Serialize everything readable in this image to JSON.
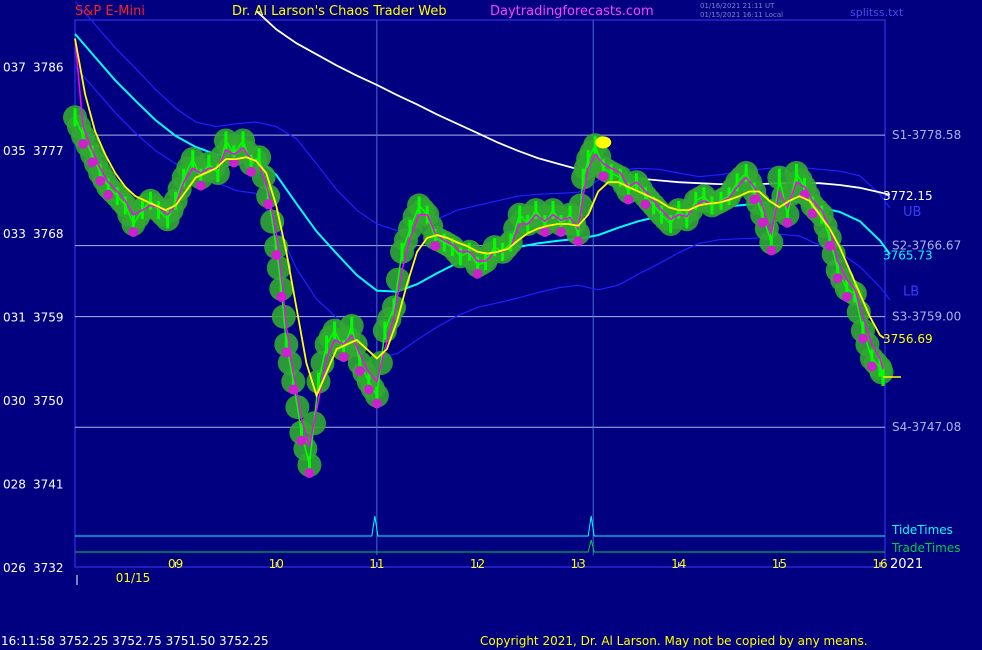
{
  "header": {
    "instrument": "S&P E-Mini",
    "author": "Dr. Al Larson's Chaos Trader Web",
    "site": "Daytradingforecasts.com",
    "stamp_ut": "01/16/2021 21:11 UT",
    "stamp_local": "01/15/2021 16:11 Local",
    "file": "splitss.txt"
  },
  "footer": {
    "quote": "16:11:58  3752.25 3752.75 3751.50 3752.25",
    "copyright": "Copyright 2021, Dr. Al Larson. May not be copied by any means."
  },
  "colors": {
    "background": "#000080",
    "price": "#00ff00",
    "glow": "#32a832",
    "ema_fast": "#ff00ff",
    "ema_slow": "#ffff00",
    "long_ma": "#ffffff",
    "band_mid": "#00ffff",
    "band_edge": "#2020ff",
    "grid": "#aab4ee"
  },
  "chart_data": {
    "type": "line",
    "title": "S&P E-Mini",
    "x_unit": "hour of 01/15",
    "xlim": [
      8.0,
      16.05
    ],
    "ylim": [
      3732,
      3791
    ],
    "x_date_label": "01/15",
    "x_year_label": "2021",
    "x_ticks": [
      {
        "x": 9,
        "label": "09"
      },
      {
        "x": 10,
        "label": "10"
      },
      {
        "x": 11,
        "label": "11"
      },
      {
        "x": 12,
        "label": "12"
      },
      {
        "x": 13,
        "label": "13"
      },
      {
        "x": 14,
        "label": "14"
      },
      {
        "x": 15,
        "label": "15"
      },
      {
        "x": 16,
        "label": "16"
      }
    ],
    "y_ticks": [
      {
        "y": 3786,
        "left": "037",
        "label": "3786"
      },
      {
        "y": 3777,
        "left": "035",
        "label": "3777"
      },
      {
        "y": 3768,
        "left": "033",
        "label": "3768"
      },
      {
        "y": 3759,
        "left": "031",
        "label": "3759"
      },
      {
        "y": 3750,
        "left": "030",
        "label": "3750"
      },
      {
        "y": 3741,
        "left": "028",
        "label": "3741"
      },
      {
        "y": 3732,
        "left": "026",
        "label": "3732"
      }
    ],
    "levels": [
      {
        "name": "S1",
        "value": 3778.58,
        "label": "S1-3778.58"
      },
      {
        "name": "S2",
        "value": 3766.67,
        "label": "S2-3766.67"
      },
      {
        "name": "S3",
        "value": 3759.0,
        "label": "S3-3759.00"
      },
      {
        "name": "S4",
        "value": 3747.08,
        "label": "S4-3747.08"
      }
    ],
    "right_values": [
      {
        "value": 3772.15,
        "label": "3772.15",
        "color": "#ffffff"
      },
      {
        "value": 3765.73,
        "label": "3765.73",
        "color": "#00ffff"
      },
      {
        "value": 3756.69,
        "label": "3756.69",
        "color": "#ffff00"
      }
    ],
    "band_labels": [
      {
        "text": "UB",
        "value": 3770.3
      },
      {
        "text": "LB",
        "value": 3761.7
      }
    ],
    "vertical_markers": [
      11.0,
      13.15
    ],
    "timing_rows": [
      {
        "name": "TideTimes",
        "color": "#00ffff",
        "spikes": [
          10.98,
          13.13
        ]
      },
      {
        "name": "TradeTimes",
        "color": "#00cc44",
        "spikes": [
          13.13
        ]
      }
    ],
    "series": [
      {
        "name": "price",
        "x": [
          8.0,
          8.08,
          8.17,
          8.25,
          8.33,
          8.42,
          8.5,
          8.58,
          8.67,
          8.75,
          8.83,
          8.92,
          9.0,
          9.08,
          9.17,
          9.25,
          9.33,
          9.42,
          9.5,
          9.58,
          9.67,
          9.75,
          9.83,
          9.92,
          10.0,
          10.05,
          10.1,
          10.17,
          10.25,
          10.33,
          10.42,
          10.5,
          10.58,
          10.67,
          10.75,
          10.83,
          10.92,
          11.0,
          11.08,
          11.17,
          11.25,
          11.33,
          11.42,
          11.5,
          11.58,
          11.67,
          11.75,
          11.83,
          11.92,
          12.0,
          12.08,
          12.17,
          12.25,
          12.33,
          12.42,
          12.5,
          12.58,
          12.67,
          12.75,
          12.83,
          12.92,
          13.0,
          13.05,
          13.1,
          13.17,
          13.25,
          13.33,
          13.42,
          13.5,
          13.58,
          13.67,
          13.75,
          13.83,
          13.92,
          14.0,
          14.08,
          14.17,
          14.25,
          14.33,
          14.42,
          14.5,
          14.58,
          14.67,
          14.75,
          14.83,
          14.92,
          15.0,
          15.08,
          15.17,
          15.25,
          15.33,
          15.42,
          15.5,
          15.58,
          15.67,
          15.75,
          15.83,
          15.92,
          16.0,
          16.03
        ],
        "y": [
          3780.5,
          3778.5,
          3776.5,
          3774.5,
          3773,
          3772,
          3771,
          3769,
          3770.5,
          3771.5,
          3770.5,
          3769.5,
          3771.5,
          3774,
          3776,
          3774,
          3775.5,
          3774.5,
          3778,
          3776.5,
          3778,
          3775.5,
          3776.2,
          3772,
          3766.5,
          3762,
          3756,
          3752,
          3746.5,
          3743,
          3752,
          3756,
          3757.5,
          3755.5,
          3758,
          3754,
          3752,
          3750.5,
          3757.5,
          3760,
          3766,
          3768.5,
          3771,
          3770,
          3767.5,
          3767,
          3766.5,
          3765.5,
          3766,
          3764.5,
          3765,
          3766.5,
          3766,
          3767,
          3770,
          3769,
          3770.5,
          3769,
          3770.5,
          3769,
          3770,
          3768,
          3774,
          3776,
          3777.5,
          3775,
          3774.5,
          3774,
          3772.5,
          3773.5,
          3772,
          3771,
          3770,
          3769,
          3770.5,
          3769.5,
          3771.5,
          3772,
          3771,
          3771.5,
          3772,
          3773.5,
          3774.5,
          3772.5,
          3770,
          3767,
          3774,
          3770,
          3774.5,
          3773,
          3771,
          3770,
          3767.5,
          3764,
          3762,
          3761.5,
          3757.5,
          3754.5,
          3753.5,
          3752.5
        ]
      },
      {
        "name": "fast_avg",
        "x": [
          8.0,
          8.08,
          8.17,
          8.25,
          8.33,
          8.42,
          8.5,
          8.58,
          8.67,
          8.75,
          8.83,
          8.92,
          9.0,
          9.08,
          9.17,
          9.25,
          9.33,
          9.42,
          9.5,
          9.58,
          9.67,
          9.75,
          9.83,
          9.92,
          10.0,
          10.05,
          10.1,
          10.17,
          10.25,
          10.33,
          10.42,
          10.5,
          10.58,
          10.67,
          10.75,
          10.83,
          10.92,
          11.0,
          11.08,
          11.17,
          11.25,
          11.33,
          11.42,
          11.5,
          11.58,
          11.67,
          11.75,
          11.83,
          11.92,
          12.0,
          12.08,
          12.17,
          12.25,
          12.33,
          12.42,
          12.5,
          12.58,
          12.67,
          12.75,
          12.83,
          12.92,
          13.0,
          13.05,
          13.1,
          13.17,
          13.25,
          13.33,
          13.42,
          13.5,
          13.58,
          13.67,
          13.75,
          13.83,
          13.92,
          14.0,
          14.08,
          14.17,
          14.25,
          14.33,
          14.42,
          14.5,
          14.58,
          14.67,
          14.75,
          14.83,
          14.92,
          15.0,
          15.08,
          15.17,
          15.25,
          15.33,
          15.42,
          15.5,
          15.58,
          15.67,
          15.75,
          15.83,
          15.92,
          16.0,
          16.03
        ],
        "y": [
          3789,
          3779.5,
          3777,
          3775,
          3773.5,
          3772.5,
          3771.5,
          3770,
          3770.5,
          3771,
          3770.8,
          3770,
          3771,
          3773.5,
          3775,
          3774.5,
          3775,
          3775,
          3777,
          3776.5,
          3777.2,
          3776,
          3775.5,
          3772.5,
          3768,
          3763.5,
          3758,
          3753,
          3748,
          3745,
          3750,
          3754.5,
          3756.5,
          3756,
          3757,
          3755,
          3753,
          3752,
          3755.5,
          3759,
          3764,
          3767.5,
          3770,
          3770,
          3768,
          3767.2,
          3766.8,
          3766,
          3766,
          3765,
          3765,
          3766,
          3766,
          3766.5,
          3769,
          3769,
          3770,
          3769.3,
          3770,
          3769.4,
          3769.7,
          3768.5,
          3772,
          3775,
          3776.5,
          3775.5,
          3775,
          3774.5,
          3773,
          3773.5,
          3772.5,
          3771.5,
          3770.5,
          3769.5,
          3770,
          3769.8,
          3771,
          3771.5,
          3771.2,
          3771.4,
          3771.8,
          3773,
          3774,
          3773,
          3771,
          3768,
          3772.5,
          3770.8,
          3773.5,
          3773,
          3771.5,
          3770.5,
          3768.5,
          3765,
          3763,
          3762,
          3759,
          3756,
          3754.5,
          3753.3
        ]
      },
      {
        "name": "slow_avg",
        "x": [
          8.0,
          8.1,
          8.2,
          8.3,
          8.4,
          8.5,
          8.6,
          8.7,
          8.8,
          8.9,
          9.0,
          9.1,
          9.2,
          9.3,
          9.4,
          9.5,
          9.6,
          9.7,
          9.8,
          9.9,
          10.0,
          10.1,
          10.2,
          10.3,
          10.4,
          10.5,
          10.6,
          10.7,
          10.8,
          10.9,
          11.0,
          11.1,
          11.2,
          11.3,
          11.4,
          11.5,
          11.6,
          11.7,
          11.8,
          11.9,
          12.0,
          12.1,
          12.2,
          12.3,
          12.4,
          12.5,
          12.6,
          12.7,
          12.8,
          12.9,
          13.0,
          13.1,
          13.2,
          13.3,
          13.4,
          13.5,
          13.6,
          13.7,
          13.8,
          13.9,
          14.0,
          14.1,
          14.2,
          14.3,
          14.4,
          14.5,
          14.6,
          14.7,
          14.8,
          14.9,
          15.0,
          15.1,
          15.2,
          15.3,
          15.4,
          15.5,
          15.6,
          15.7,
          15.8,
          15.9,
          16.0,
          16.04
        ],
        "y": [
          3789,
          3783,
          3779,
          3776.5,
          3774.5,
          3773,
          3772,
          3771.5,
          3771,
          3770.5,
          3771,
          3772.5,
          3774,
          3774.5,
          3775,
          3776,
          3776,
          3776.2,
          3775.8,
          3774.5,
          3771,
          3766,
          3760,
          3754,
          3750.5,
          3753,
          3755.5,
          3756,
          3756.5,
          3755.5,
          3754.5,
          3755.5,
          3758.5,
          3762.5,
          3766,
          3767.5,
          3767.8,
          3767.5,
          3767,
          3766.6,
          3766,
          3765.8,
          3766,
          3766.3,
          3767.2,
          3768,
          3768.5,
          3768.8,
          3769,
          3769,
          3768.8,
          3770,
          3772.5,
          3773.5,
          3773.5,
          3773,
          3772.5,
          3772,
          3771.5,
          3770.8,
          3770.5,
          3770.5,
          3771,
          3771.2,
          3771.3,
          3771.6,
          3772,
          3772.5,
          3772.5,
          3771.5,
          3770.8,
          3771.5,
          3772,
          3771.5,
          3770,
          3768.5,
          3766.5,
          3764,
          3761.5,
          3759,
          3757,
          3756.7
        ]
      },
      {
        "name": "long_avg",
        "x": [
          9.8,
          10.0,
          10.2,
          10.4,
          10.6,
          10.8,
          11.0,
          11.2,
          11.4,
          11.6,
          11.8,
          12.0,
          12.2,
          12.4,
          12.6,
          12.8,
          13.0,
          13.2,
          13.4,
          13.6,
          13.8,
          14.0,
          14.2,
          14.4,
          14.6,
          14.8,
          15.0,
          15.2,
          15.4,
          15.6,
          15.8,
          16.0,
          16.1
        ],
        "y": [
          3792,
          3790,
          3788.5,
          3787.3,
          3786.1,
          3785,
          3784,
          3782.9,
          3781.9,
          3780.8,
          3779.8,
          3778.8,
          3777.8,
          3776.9,
          3776.1,
          3775.5,
          3774.9,
          3774.5,
          3774.2,
          3773.9,
          3773.7,
          3773.5,
          3773.4,
          3773.3,
          3773.3,
          3773.3,
          3773.4,
          3773.4,
          3773.4,
          3773.2,
          3772.9,
          3772.4,
          3772.15
        ]
      },
      {
        "name": "band_mid",
        "x": [
          8.0,
          8.2,
          8.4,
          8.6,
          8.8,
          9.0,
          9.2,
          9.4,
          9.6,
          9.8,
          10.0,
          10.2,
          10.4,
          10.6,
          10.8,
          11.0,
          11.2,
          11.4,
          11.6,
          11.8,
          12.0,
          12.2,
          12.4,
          12.6,
          12.8,
          13.0,
          13.2,
          13.4,
          13.6,
          13.8,
          14.0,
          14.2,
          14.4,
          14.6,
          14.8,
          15.0,
          15.2,
          15.4,
          15.6,
          15.8,
          16.0,
          16.1
        ],
        "y": [
          3789.5,
          3787,
          3784.5,
          3782.3,
          3780.2,
          3778.5,
          3777.3,
          3776.5,
          3776.2,
          3776.2,
          3774.3,
          3771.2,
          3768.2,
          3765.8,
          3763.5,
          3761.8,
          3761.7,
          3762.5,
          3763.7,
          3764.8,
          3765.5,
          3766,
          3766.5,
          3766.9,
          3767.2,
          3767.4,
          3767.8,
          3768.6,
          3769.3,
          3769.8,
          3770.2,
          3770.5,
          3770.8,
          3771,
          3771.2,
          3771.5,
          3771.4,
          3770.8,
          3770.3,
          3769.3,
          3767.2,
          3765.73
        ]
      },
      {
        "name": "band_upper",
        "x": [
          8.0,
          8.2,
          8.4,
          8.6,
          8.8,
          9.0,
          9.2,
          9.4,
          9.6,
          9.8,
          10.0,
          10.2,
          10.4,
          10.6,
          10.8,
          11.0,
          11.2,
          11.4,
          11.6,
          11.8,
          12.0,
          12.2,
          12.4,
          12.6,
          12.8,
          13.0,
          13.2,
          13.4,
          13.6,
          13.8,
          14.0,
          14.2,
          14.4,
          14.6,
          14.8,
          15.0,
          15.2,
          15.4,
          15.6,
          15.8,
          16.0,
          16.1
        ],
        "y": [
          3793,
          3790.5,
          3788,
          3785.8,
          3783.5,
          3781.5,
          3780,
          3779.5,
          3779.8,
          3780,
          3779.5,
          3778.2,
          3775.5,
          3772.7,
          3770.5,
          3769,
          3768.3,
          3768.5,
          3769.5,
          3770.5,
          3771,
          3771.5,
          3772,
          3772.2,
          3772.3,
          3772.4,
          3773.7,
          3774.8,
          3775,
          3774.9,
          3774.5,
          3774.1,
          3774.3,
          3774.6,
          3774.9,
          3775.1,
          3775.1,
          3774.9,
          3774.7,
          3774.2,
          3772.2,
          3770.7
        ]
      },
      {
        "name": "band_lower",
        "x": [
          8.0,
          8.2,
          8.4,
          8.6,
          8.8,
          9.0,
          9.2,
          9.4,
          9.6,
          9.8,
          10.0,
          10.2,
          10.4,
          10.6,
          10.8,
          11.0,
          11.2,
          11.4,
          11.6,
          11.8,
          12.0,
          12.2,
          12.4,
          12.6,
          12.8,
          13.0,
          13.2,
          13.4,
          13.6,
          13.8,
          14.0,
          14.2,
          14.4,
          14.6,
          14.8,
          15.0,
          15.2,
          15.4,
          15.6,
          15.8,
          16.0,
          16.1
        ],
        "y": [
          3786,
          3783.5,
          3781,
          3778.8,
          3776.9,
          3775.5,
          3774.6,
          3773.5,
          3772.6,
          3772.3,
          3769,
          3764.2,
          3760.9,
          3758.9,
          3756.5,
          3754.6,
          3755,
          3756.5,
          3757.9,
          3759.1,
          3760,
          3760.5,
          3761,
          3761.6,
          3762.1,
          3762.4,
          3761.9,
          3762.4,
          3763.6,
          3764.7,
          3765.9,
          3766.9,
          3767.3,
          3767.4,
          3767.5,
          3767.9,
          3767.7,
          3766.7,
          3765.9,
          3764.4,
          3762.2,
          3760.8
        ]
      }
    ]
  }
}
